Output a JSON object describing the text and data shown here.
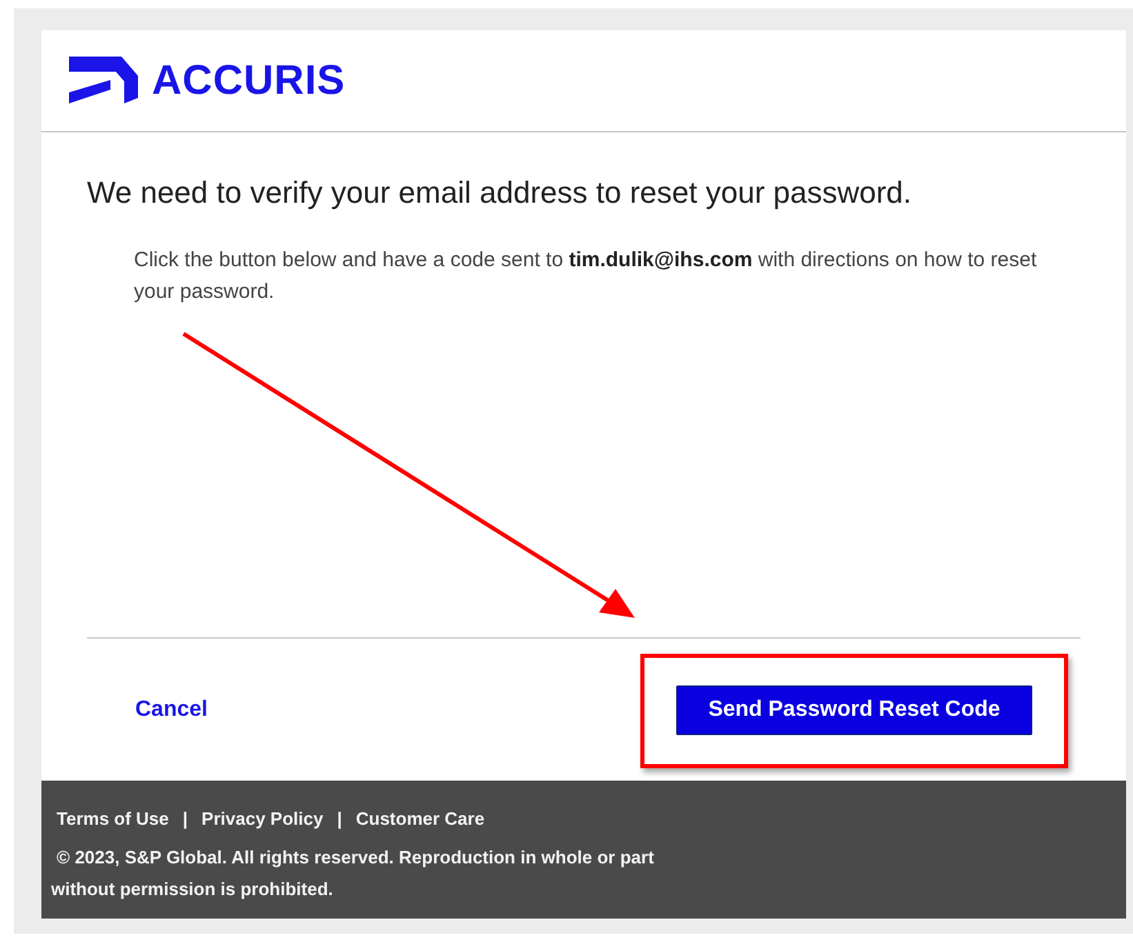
{
  "header": {
    "logo_text": "ACCURIS"
  },
  "heading": "We need to verify your email address to reset your password.",
  "message": "Click the button below and have a code sent to **tim.dulik@ihs.com** with directions on how to reset your password.",
  "actions": {
    "cancel": "Cancel",
    "submit": "Send Password Reset Code"
  },
  "footer": {
    "links": [
      "Terms of Use",
      "Privacy Policy",
      "Customer Care"
    ],
    "separator": "|",
    "copyright": "© 2023, S&P Global. All rights reserved. Reproduction in whole or part",
    "copyright_line_2": "without permission is prohibited."
  }
}
